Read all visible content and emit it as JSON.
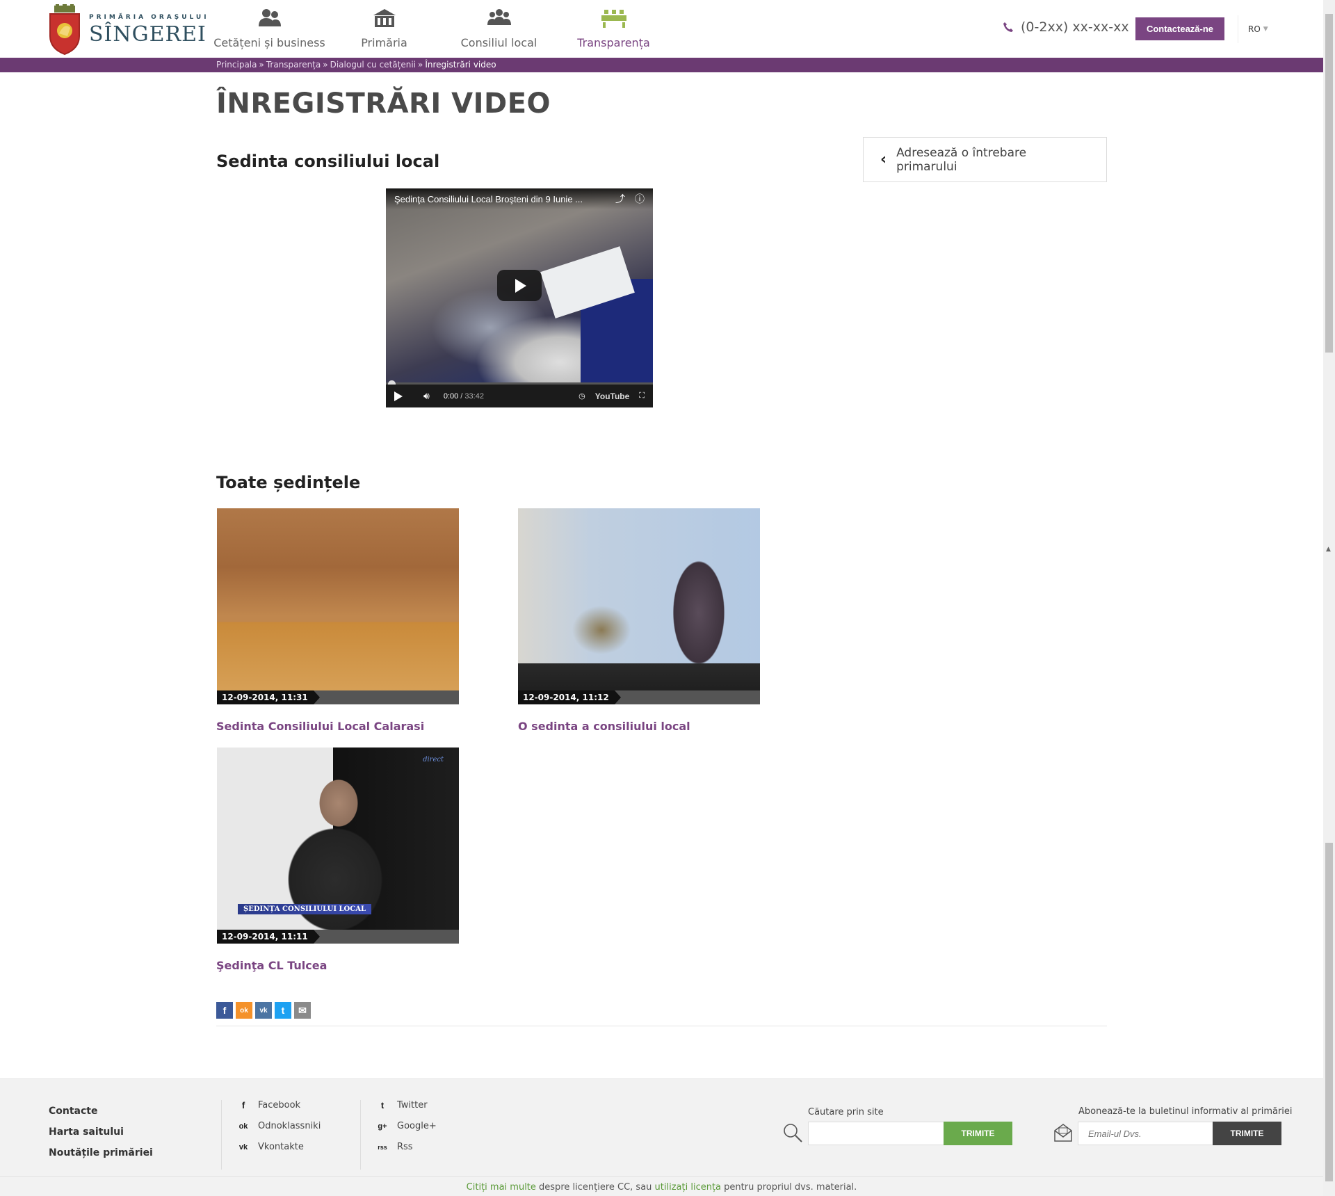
{
  "header": {
    "logo_small": "PRIMĂRIA ORAȘULUI",
    "logo_big": "SÎNGEREI",
    "nav": [
      {
        "label": "Cetățeni și business",
        "icon": "people-icon"
      },
      {
        "label": "Primăria",
        "icon": "building-icon"
      },
      {
        "label": "Consiliul local",
        "icon": "council-icon"
      },
      {
        "label": "Transparența",
        "icon": "transparency-icon",
        "active": true
      }
    ],
    "phone": "(0-2xx) xx-xx-xx",
    "contact_label": "Contactează-ne",
    "lang": "RO",
    "accent": "#7a4582"
  },
  "breadcrumb": {
    "items": [
      "Principala",
      "Transparența",
      "Dialogul cu cetățenii"
    ],
    "current": "Înregistrări video",
    "separator": "»"
  },
  "main": {
    "title": "ÎNREGISTRĂRI VIDEO",
    "featured_heading": "Sedinta consiliului local",
    "ask_label": "Adresează o întrebare primarului",
    "video": {
      "title": "Şedinţa Consiliului Local Broşteni din 9 Iunie ...",
      "time": "0:00",
      "duration": "33:42",
      "brand": "YouTube"
    },
    "all_heading": "Toate ședințele",
    "sessions": [
      {
        "date": "12-09-2014, 11:31",
        "title": "Sedinta Consiliului Local Calarasi"
      },
      {
        "date": "12-09-2014, 11:12",
        "title": "O sedinta a consiliului local"
      },
      {
        "date": "12-09-2014, 11:11",
        "title": "Şedinţa CL Tulcea",
        "caption": "ȘEDINȚA CONSILIULUI LOCAL",
        "logo": "direct"
      }
    ],
    "share": [
      "f",
      "ok",
      "vk",
      "t",
      "✉"
    ]
  },
  "footer": {
    "links": [
      "Contacte",
      "Harta saitului",
      "Noutățile primăriei"
    ],
    "social_col1": [
      {
        "icon": "f",
        "label": "Facebook"
      },
      {
        "icon": "ok",
        "label": "Odnoklassniki"
      },
      {
        "icon": "vk",
        "label": "Vkontakte"
      }
    ],
    "social_col2": [
      {
        "icon": "t",
        "label": "Twitter"
      },
      {
        "icon": "g+",
        "label": "Google+"
      },
      {
        "icon": "rss",
        "label": "Rss"
      }
    ],
    "search_label": "Căutare prin site",
    "search_button": "TRIMITE",
    "subscribe_label": "Abonează-te la buletinul informativ al primăriei",
    "subscribe_placeholder": "Email-ul Dvs.",
    "subscribe_button": "TRIMITE",
    "license": {
      "link1": "Citiți mai multe",
      "text1": " despre licențiere CC, sau ",
      "link2": "utilizați licența",
      "text2": " pentru propriul dvs. material."
    }
  }
}
